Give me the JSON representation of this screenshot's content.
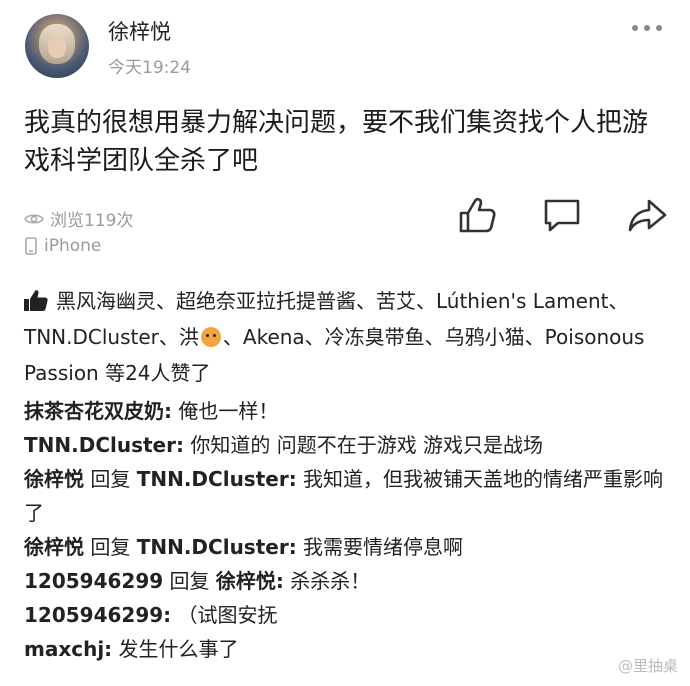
{
  "post": {
    "author": "徐梓悦",
    "time": "今天19:24",
    "content": "我真的很想用暴力解决问题，要不我们集资找个人把游戏科学团队全杀了吧",
    "views": "浏览119次",
    "device": "iPhone"
  },
  "likes": {
    "users_before_icon": "黑风海幽灵、超绝奈亚拉托提普酱、苦艾、Lúthien's Lament、TNN.DCluster、洪",
    "users_after_icon": "、Akena、冷冻臭带鱼、乌鸦小猫、Poisonous Passion 等24人赞了"
  },
  "comments": [
    {
      "name": "抹茶杏花双皮奶:",
      "text": " 俺也一样！"
    },
    {
      "name": "TNN.DCluster:",
      "text": " 你知道的 问题不在于游戏 游戏只是战场"
    },
    {
      "name": "徐梓悦",
      "reply": " 回复 ",
      "reply_to": "TNN.DCluster:",
      "text": " 我知道，但我被铺天盖地的情绪严重影响了"
    },
    {
      "name": "徐梓悦",
      "reply": " 回复 ",
      "reply_to": "TNN.DCluster:",
      "text": " 我需要情绪停息啊"
    },
    {
      "name": "1205946299",
      "reply": " 回复 ",
      "reply_to": "徐梓悦:",
      "text": " 杀杀杀！"
    },
    {
      "name": "1205946299:",
      "text": " （试图安抚"
    },
    {
      "name": "maxchj:",
      "text": " 发生什么事了"
    }
  ],
  "watermark": "@里抽桌",
  "icons": {
    "more": "more-dots-icon",
    "view": "eye-icon",
    "device": "phone-icon",
    "like": "thumbs-up-icon",
    "comment": "comment-bubble-icon",
    "share": "share-arrow-icon",
    "likes_header": "thumbs-up-filled-icon",
    "tiger": "tiger-emoji-icon"
  },
  "colors": {
    "text": "#222222",
    "muted": "#9a9a9a",
    "background": "#ffffff"
  }
}
